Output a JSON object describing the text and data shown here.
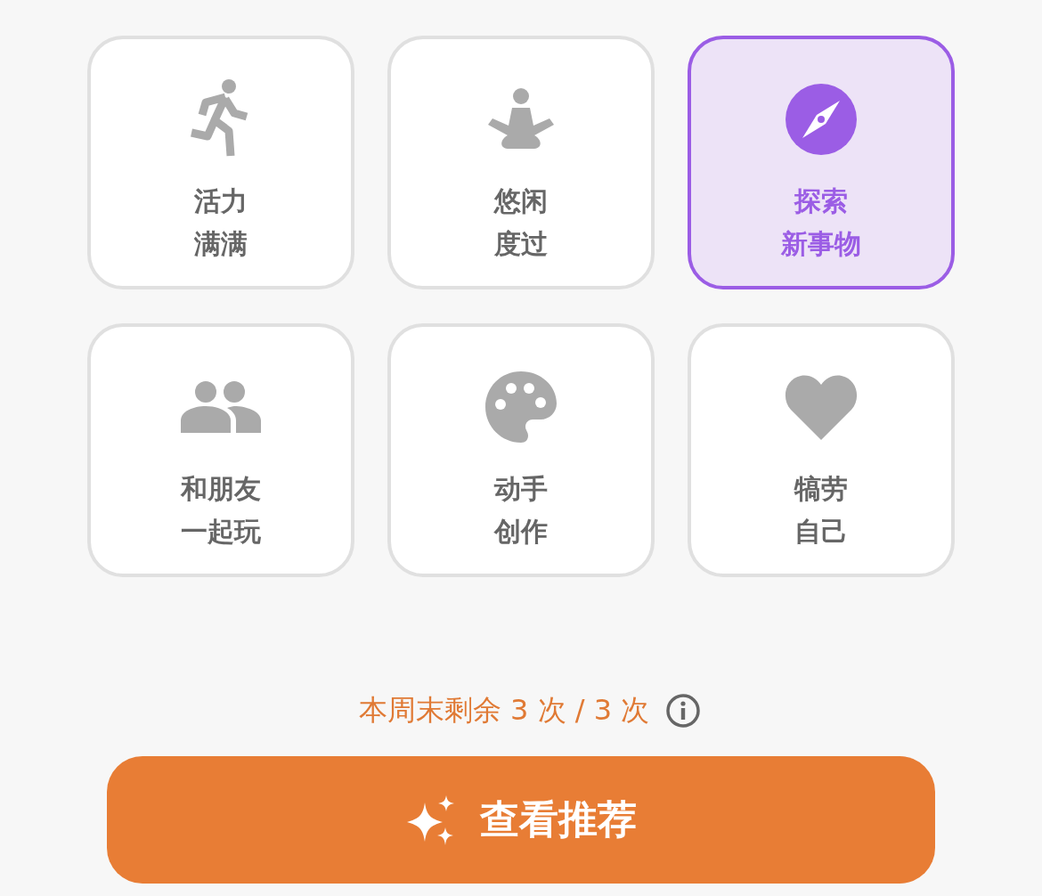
{
  "moods": [
    {
      "lines": [
        "活力",
        "满满"
      ],
      "selected": false
    },
    {
      "lines": [
        "悠闲",
        "度过"
      ],
      "selected": false
    },
    {
      "lines": [
        "探索",
        "新事物"
      ],
      "selected": true
    },
    {
      "lines": [
        "和朋友",
        "一起玩"
      ],
      "selected": false
    },
    {
      "lines": [
        "动手",
        "创作"
      ],
      "selected": false
    },
    {
      "lines": [
        "犒劳",
        "自己"
      ],
      "selected": false
    }
  ],
  "quota": {
    "text": "本周末剩余 3 次 / 3 次"
  },
  "action_button": {
    "label": "查看推荐"
  }
}
